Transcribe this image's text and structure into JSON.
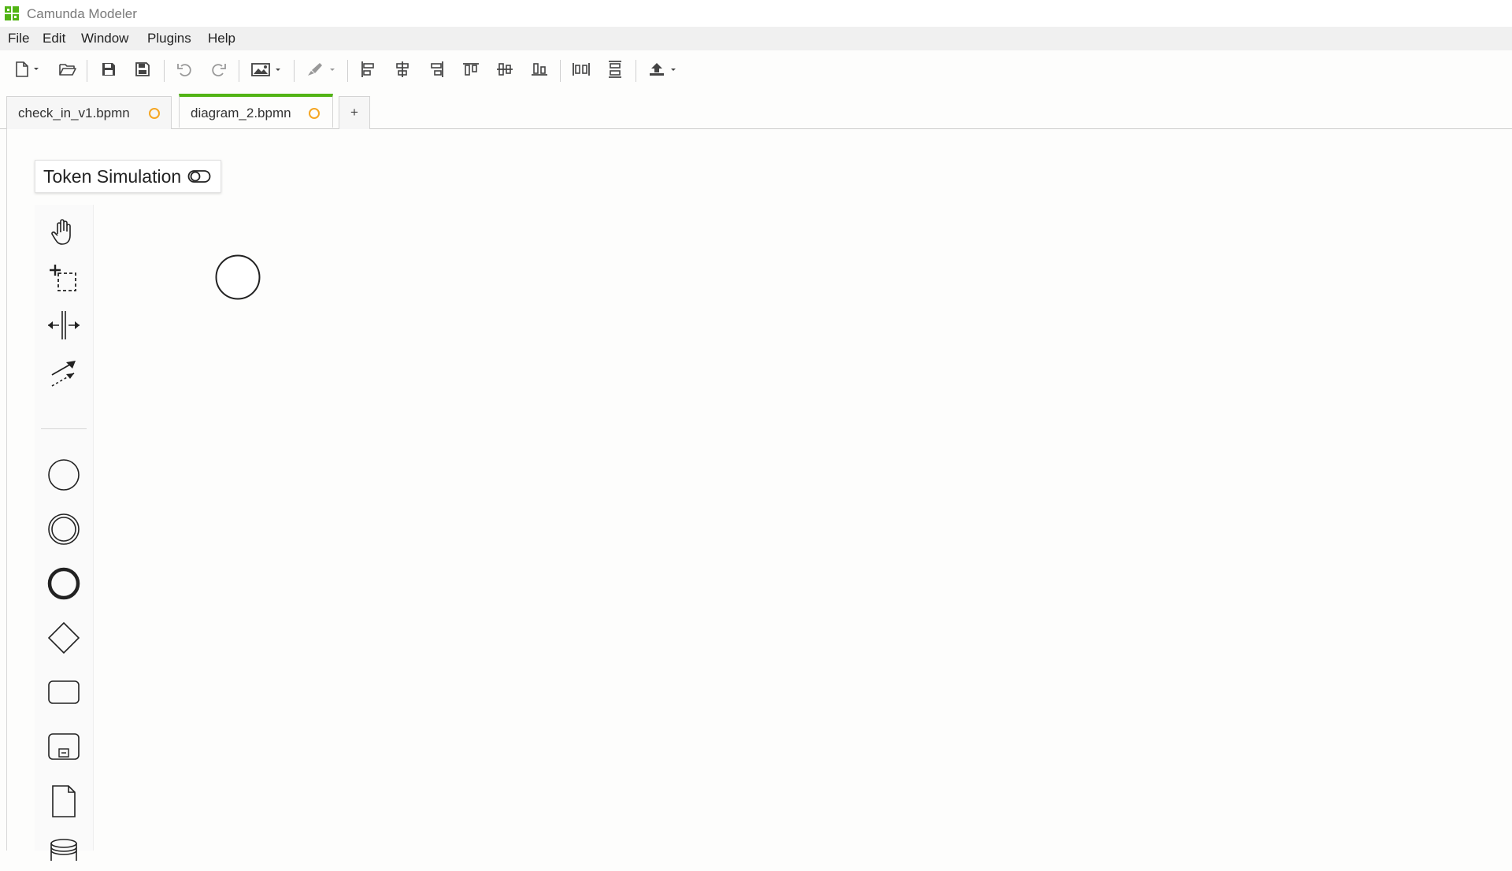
{
  "window": {
    "title": "Camunda Modeler",
    "accent_color": "#52b415"
  },
  "menu": {
    "items": [
      {
        "label": "File"
      },
      {
        "label": "Edit"
      },
      {
        "label": "Window"
      },
      {
        "label": "Plugins"
      },
      {
        "label": "Help"
      }
    ]
  },
  "toolbar": {
    "buttons": [
      {
        "icon": "new-file-icon"
      },
      {
        "icon": "open-folder-icon"
      },
      {
        "icon": "save-icon"
      },
      {
        "icon": "save-as-icon"
      },
      {
        "icon": "undo-icon"
      },
      {
        "icon": "redo-icon"
      },
      {
        "icon": "image-export-icon"
      },
      {
        "icon": "color-brush-icon"
      },
      {
        "icon": "align-left-icon"
      },
      {
        "icon": "align-center-icon"
      },
      {
        "icon": "align-right-icon"
      },
      {
        "icon": "align-top-icon"
      },
      {
        "icon": "align-middle-icon"
      },
      {
        "icon": "align-bottom-icon"
      },
      {
        "icon": "distribute-horizontal-icon"
      },
      {
        "icon": "distribute-vertical-icon"
      },
      {
        "icon": "deploy-icon"
      }
    ]
  },
  "tabs": [
    {
      "label": "check_in_v1.bpmn",
      "unsaved": true,
      "active": false
    },
    {
      "label": "diagram_2.bpmn",
      "unsaved": true,
      "active": true
    }
  ],
  "tab_add_label": "+",
  "canvas": {
    "token_simulation_label": "Token Simulation",
    "palette_tools": [
      "hand-tool-icon",
      "lasso-tool-icon",
      "space-tool-icon",
      "global-connect-tool-icon",
      "start-event-icon",
      "intermediate-event-icon",
      "end-event-icon",
      "gateway-icon",
      "task-icon",
      "subprocess-icon",
      "data-object-icon",
      "data-store-icon"
    ],
    "diagram_elements": [
      {
        "type": "start-event"
      }
    ]
  }
}
